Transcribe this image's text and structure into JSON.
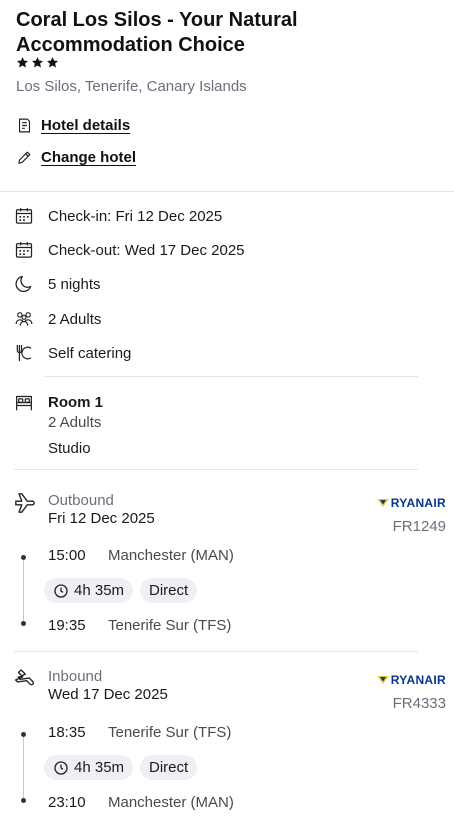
{
  "hotel": {
    "name": "Coral Los Silos - Your Natural Accommodation Choice",
    "star_rating": 3,
    "location": "Los Silos, Tenerife, Canary Islands"
  },
  "actions": {
    "hotel_details": "Hotel details",
    "change_hotel": "Change hotel"
  },
  "stay": {
    "check_in": "Check-in: Fri 12 Dec 2025",
    "check_out": "Check-out: Wed 17 Dec 2025",
    "nights": "5 nights",
    "guests": "2 Adults",
    "board": "Self catering"
  },
  "room": {
    "title": "Room 1",
    "occupancy": "2 Adults",
    "type": "Studio"
  },
  "flights": {
    "outbound": {
      "label": "Outbound",
      "date": "Fri 12 Dec 2025",
      "airline": "RYANAIR",
      "flight_number": "FR1249",
      "depart_time": "15:00",
      "depart_airport": "Manchester (MAN)",
      "duration": "4h 35m",
      "stops": "Direct",
      "arrive_time": "19:35",
      "arrive_airport": "Tenerife Sur (TFS)"
    },
    "inbound": {
      "label": "Inbound",
      "date": "Wed 17 Dec 2025",
      "airline": "RYANAIR",
      "flight_number": "FR4333",
      "depart_time": "18:35",
      "depart_airport": "Tenerife Sur (TFS)",
      "duration": "4h 35m",
      "stops": "Direct",
      "arrive_time": "23:10",
      "arrive_airport": "Manchester (MAN)"
    }
  },
  "colors": {
    "airline_brand": "#073590",
    "airline_harp": "#F1C933",
    "chip_bg": "#eef0f4",
    "muted_text": "#6b6f7d"
  },
  "icons": {
    "details": "document-icon",
    "change": "pencil-icon",
    "check_in": "calendar-icon",
    "check_out": "calendar-icon",
    "nights": "moon-icon",
    "guests": "people-icon",
    "board": "cutlery-icon",
    "room": "bed-icon",
    "outbound": "plane-departure-icon",
    "inbound": "plane-arrival-icon",
    "duration": "clock-icon"
  }
}
